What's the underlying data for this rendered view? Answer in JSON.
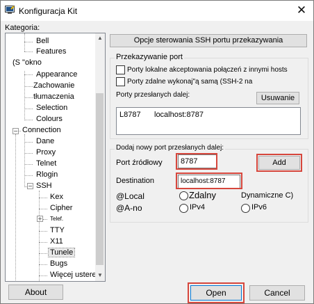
{
  "window": {
    "title": "Konfiguracja Kit",
    "close_glyph": "✕"
  },
  "tree": {
    "heading": "Kategoria:",
    "items": [
      "Bell",
      "Features",
      "(S \"okno",
      "Appearance",
      "Zachowanie",
      "tłumaczenia",
      "Selection",
      "Colours",
      "Connection",
      "Dane",
      "Proxy",
      "Telnet",
      "Rlogin",
      "SSH",
      "Kex",
      "Cipher",
      "Telef.",
      "TTY",
      "X11",
      "Tunele",
      "Bugs",
      "Więcej usterek"
    ],
    "selected": "Tunele",
    "expanders": {
      "connection": "−",
      "ssh": "−",
      "telef": "+"
    }
  },
  "panel": {
    "header_button": "Opcje sterowania SSH portu przekazywania",
    "group_label": "Przekazywanie port",
    "checkbox_local": "Porty lokalne akceptowania połączeń z innymi hosts",
    "checkbox_remote": "Porty zdalne wykonaj\"ą samą (SSH-2 na",
    "forwarded_label": "Porty przesłanych dalej:",
    "remove_button": "Usuwanie",
    "forwarded_entries": [
      {
        "port": "L8787",
        "destination": "localhost:8787"
      }
    ],
    "add_new_label": "Dodaj nowy port przesłanych dalej:",
    "source_port_label": "Port źródłowy",
    "source_port_value": "8787",
    "add_button": "Add",
    "destination_label": "Destination",
    "destination_value": "localhost:8787",
    "local_label": "@Local",
    "remote_label": "Zdalny",
    "dynamic_label": "Dynamiczne C)",
    "auto_label": "@A-no",
    "ipv4_label": "IPv4",
    "ipv6_label": "IPv6"
  },
  "footer": {
    "about_button": "About",
    "open_button": "Open",
    "cancel_button": "Cancel"
  },
  "colors": {
    "highlight": "#d6463c",
    "accent": "#0078d7"
  }
}
